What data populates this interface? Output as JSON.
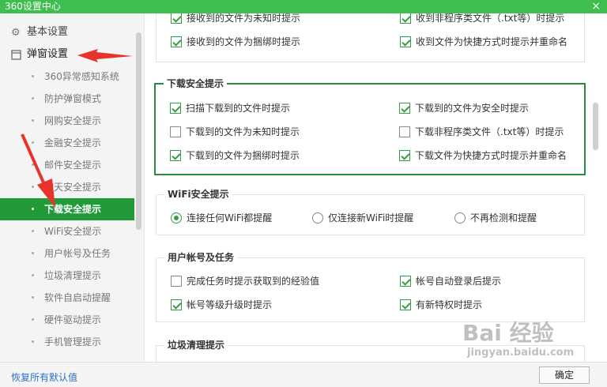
{
  "window": {
    "title": "360设置中心",
    "close_icon": "×"
  },
  "sidebar": {
    "sections": [
      {
        "label": "基本设置",
        "icon": "gear-icon"
      },
      {
        "label": "弹窗设置",
        "icon": "window-icon"
      }
    ],
    "items": [
      {
        "label": "360异常感知系统"
      },
      {
        "label": "防护弹窗模式"
      },
      {
        "label": "网购安全提示"
      },
      {
        "label": "金融安全提示"
      },
      {
        "label": "邮件安全提示"
      },
      {
        "label": "聊天安全提示"
      },
      {
        "label": "下载安全提示",
        "active": true
      },
      {
        "label": "WiFi安全提示"
      },
      {
        "label": "用户帐号及任务"
      },
      {
        "label": "垃圾清理提示"
      },
      {
        "label": "软件自启动提醒"
      },
      {
        "label": "硬件驱动提示"
      },
      {
        "label": "手机管理提示"
      }
    ]
  },
  "content": {
    "mail_group": {
      "items": [
        {
          "label": "接收到的文件为未知时提示",
          "checked": true
        },
        {
          "label": "收到非程序类文件（.txt等）时提示",
          "checked": true
        },
        {
          "label": "接收到的文件为捆绑时提示",
          "checked": true
        },
        {
          "label": "收到文件为快捷方式时提示并重命名",
          "checked": true
        }
      ]
    },
    "download_group": {
      "title": "下载安全提示",
      "items": [
        {
          "label": "扫描下载到的文件时提示",
          "checked": true
        },
        {
          "label": "下载到的文件为安全时提示",
          "checked": true
        },
        {
          "label": "下载到的文件为未知时提示",
          "checked": false
        },
        {
          "label": "下载非程序类文件（.txt等）时提示",
          "checked": false
        },
        {
          "label": "下载到的文件为捆绑时提示",
          "checked": true
        },
        {
          "label": "下载文件为快捷方式时提示并重命名",
          "checked": true
        }
      ]
    },
    "wifi_group": {
      "title": "WiFi安全提示",
      "options": [
        {
          "label": "连接任何WiFi都提醒",
          "selected": true
        },
        {
          "label": "仅连接新WiFi时提醒",
          "selected": false
        },
        {
          "label": "不再检测和提醒",
          "selected": false
        }
      ]
    },
    "account_group": {
      "title": "用户帐号及任务",
      "items": [
        {
          "label": "完成任务时提示获取到的经验值",
          "checked": false
        },
        {
          "label": "帐号自动登录后提示",
          "checked": true
        },
        {
          "label": "帐号等级升级时提示",
          "checked": true
        },
        {
          "label": "有新特权时提示",
          "checked": true
        }
      ]
    },
    "trash_group": {
      "title": "垃圾清理提示"
    }
  },
  "footer": {
    "restore_label": "恢复所有默认值",
    "ok_label": "确定"
  },
  "watermark": {
    "line1": "Bai 经验",
    "line2": "jingyan.baidu.com"
  },
  "colors": {
    "brand": "#3ebe4e",
    "active": "#239a3a",
    "check": "#3a9a45",
    "arrow": "#e8332a"
  }
}
